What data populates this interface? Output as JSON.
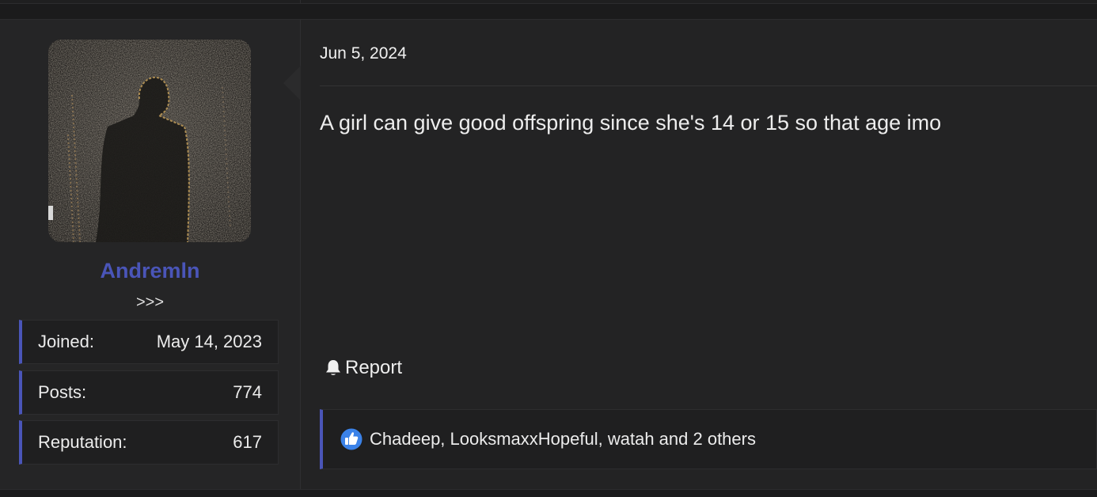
{
  "post": {
    "date": "Jun 5, 2024",
    "message": "A girl can give good offspring since she's 14 or 15 so that age imo",
    "report_label": "Report",
    "reactions_text": "Chadeep, LooksmaxxHopeful, watah and 2 others"
  },
  "user": {
    "username": "Andremln",
    "title": ">>>",
    "stats": {
      "joined_label": "Joined:",
      "joined_value": "May 14, 2023",
      "posts_label": "Posts:",
      "posts_value": "774",
      "reputation_label": "Reputation:",
      "reputation_value": "617"
    }
  },
  "colors": {
    "accent": "#4a55b8",
    "background": "#232324",
    "like_blue": "#3b82e8"
  },
  "icons": {
    "report": "bell-icon",
    "reaction": "thumbs-up-icon"
  }
}
